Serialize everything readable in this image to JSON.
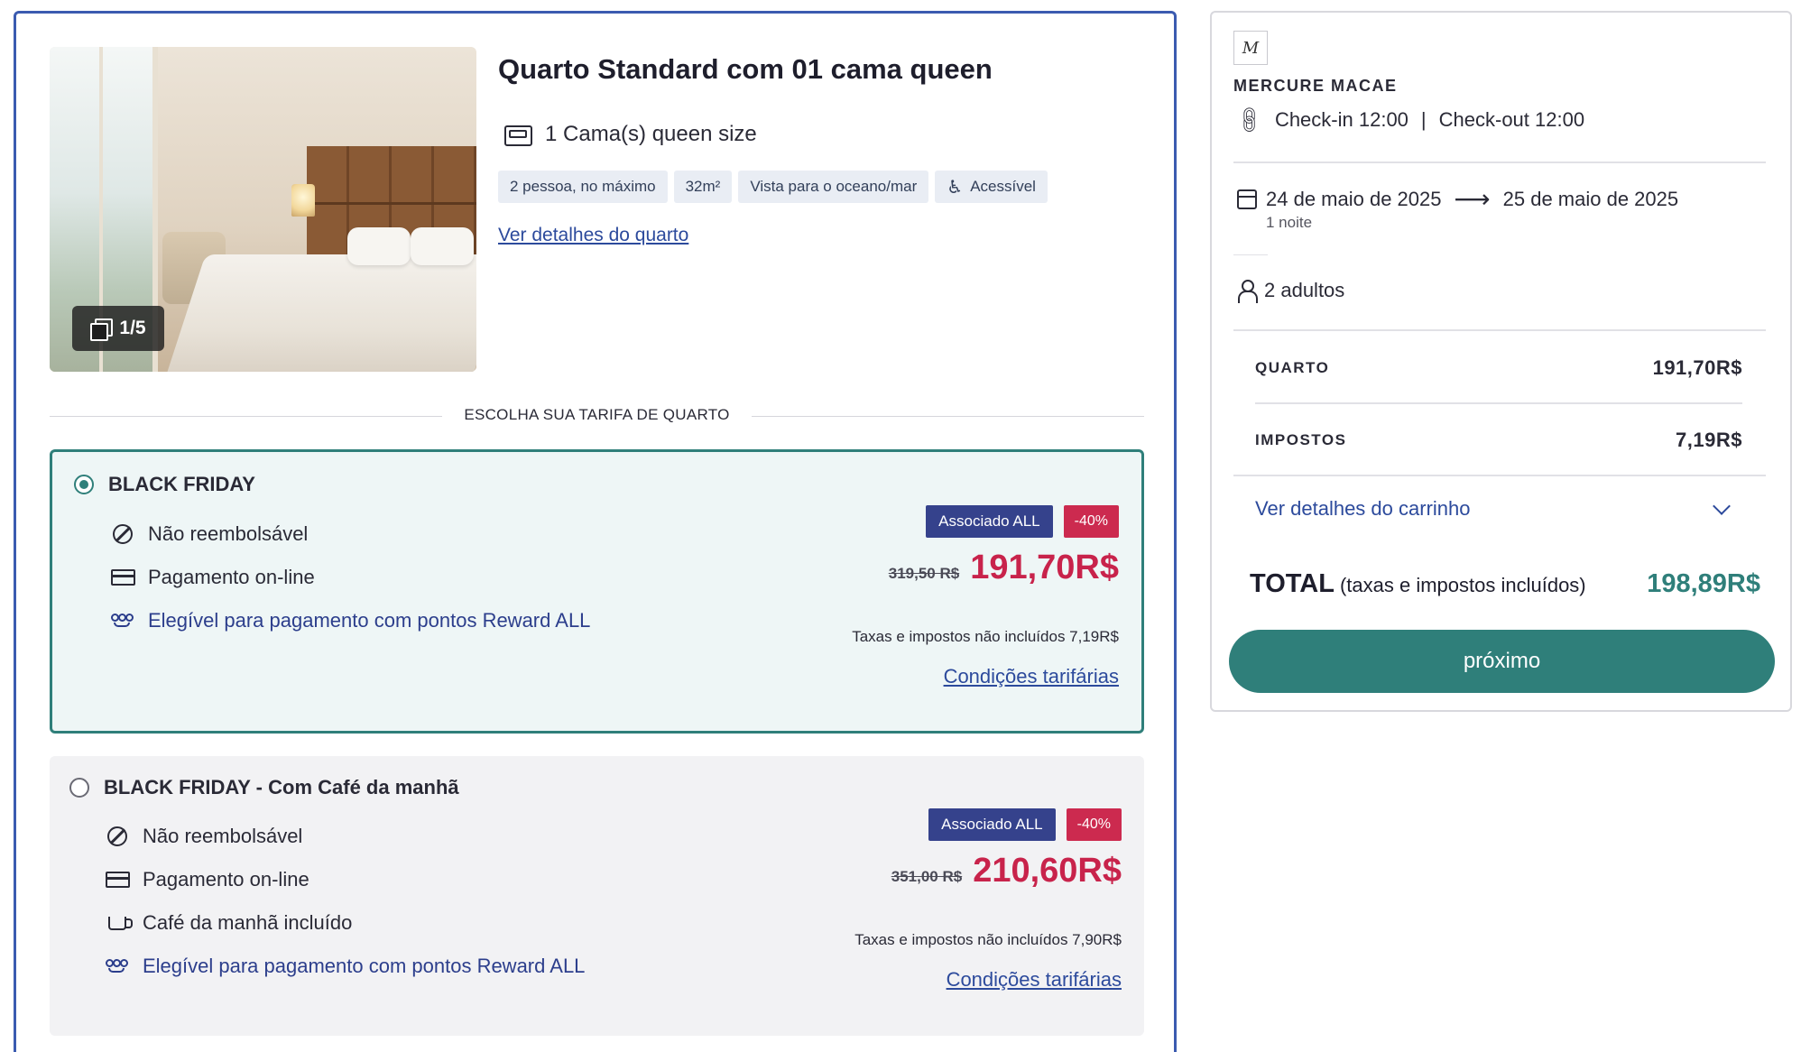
{
  "room": {
    "photo_counter": "1/5",
    "title": "Quarto Standard com 01 cama queen",
    "bed": "1 Cama(s) queen size",
    "tags": [
      "2 pessoa, no máximo",
      "32m²",
      "Vista para o oceano/mar",
      "Acessível"
    ],
    "details_link": "Ver detalhes do quarto",
    "rate_heading": "ESCOLHA SUA TARIFA DE QUARTO"
  },
  "rates": [
    {
      "name": "BLACK FRIDAY",
      "selected": true,
      "features": [
        "Não reembolsável",
        "Pagamento on-line",
        "Elegível para pagamento com pontos Reward ALL"
      ],
      "badge_member": "Associado ALL",
      "badge_discount": "-40%",
      "old_price": "319,50 R$",
      "price": "191,70R$",
      "tax_note": "Taxas e impostos não incluídos 7,19R$",
      "conditions": "Condições tarifárias"
    },
    {
      "name": "BLACK FRIDAY - Com Café da manhã",
      "selected": false,
      "features": [
        "Não reembolsável",
        "Pagamento on-line",
        "Café da manhã incluído",
        "Elegível para pagamento com pontos Reward ALL"
      ],
      "badge_member": "Associado ALL",
      "badge_discount": "-40%",
      "old_price": "351,00 R$",
      "price": "210,60R$",
      "tax_note": "Taxas e impostos não incluídos 7,90R$",
      "conditions": "Condições tarifárias"
    }
  ],
  "summary": {
    "logo_glyph": "M",
    "hotel_name": "MERCURE MACAE",
    "checkin": "Check-in 12:00",
    "divider": "|",
    "checkout": "Check-out 12:00",
    "date_from": "24 de maio de 2025",
    "date_to": "25 de maio de 2025",
    "nights": "1 noite",
    "guests": "2 adultos",
    "room_label": "QUARTO",
    "room_value": "191,70R$",
    "tax_label": "IMPOSTOS",
    "tax_value": "7,19R$",
    "cart_link": "Ver detalhes do carrinho",
    "total_label": "TOTAL",
    "total_sub": "(taxas e impostos incluídos)",
    "total_value": "198,89R$",
    "next_button": "próximo"
  },
  "colors": {
    "accent_teal": "#2f7f7a",
    "card_border": "#3b5bb0",
    "member_badge": "#35428c",
    "discount_badge": "#cc2a4f",
    "link_blue": "#2c4a9c"
  },
  "icons": [
    "gallery-icon",
    "bed-icon",
    "accessible-icon",
    "radio-selected-icon",
    "no-refund-icon",
    "credit-card-icon",
    "reward-icon",
    "coffee-cup-icon",
    "link-icon",
    "calendar-icon",
    "arrow-right-icon",
    "person-icon",
    "chevron-down-icon",
    "hotel-logo-icon"
  ]
}
